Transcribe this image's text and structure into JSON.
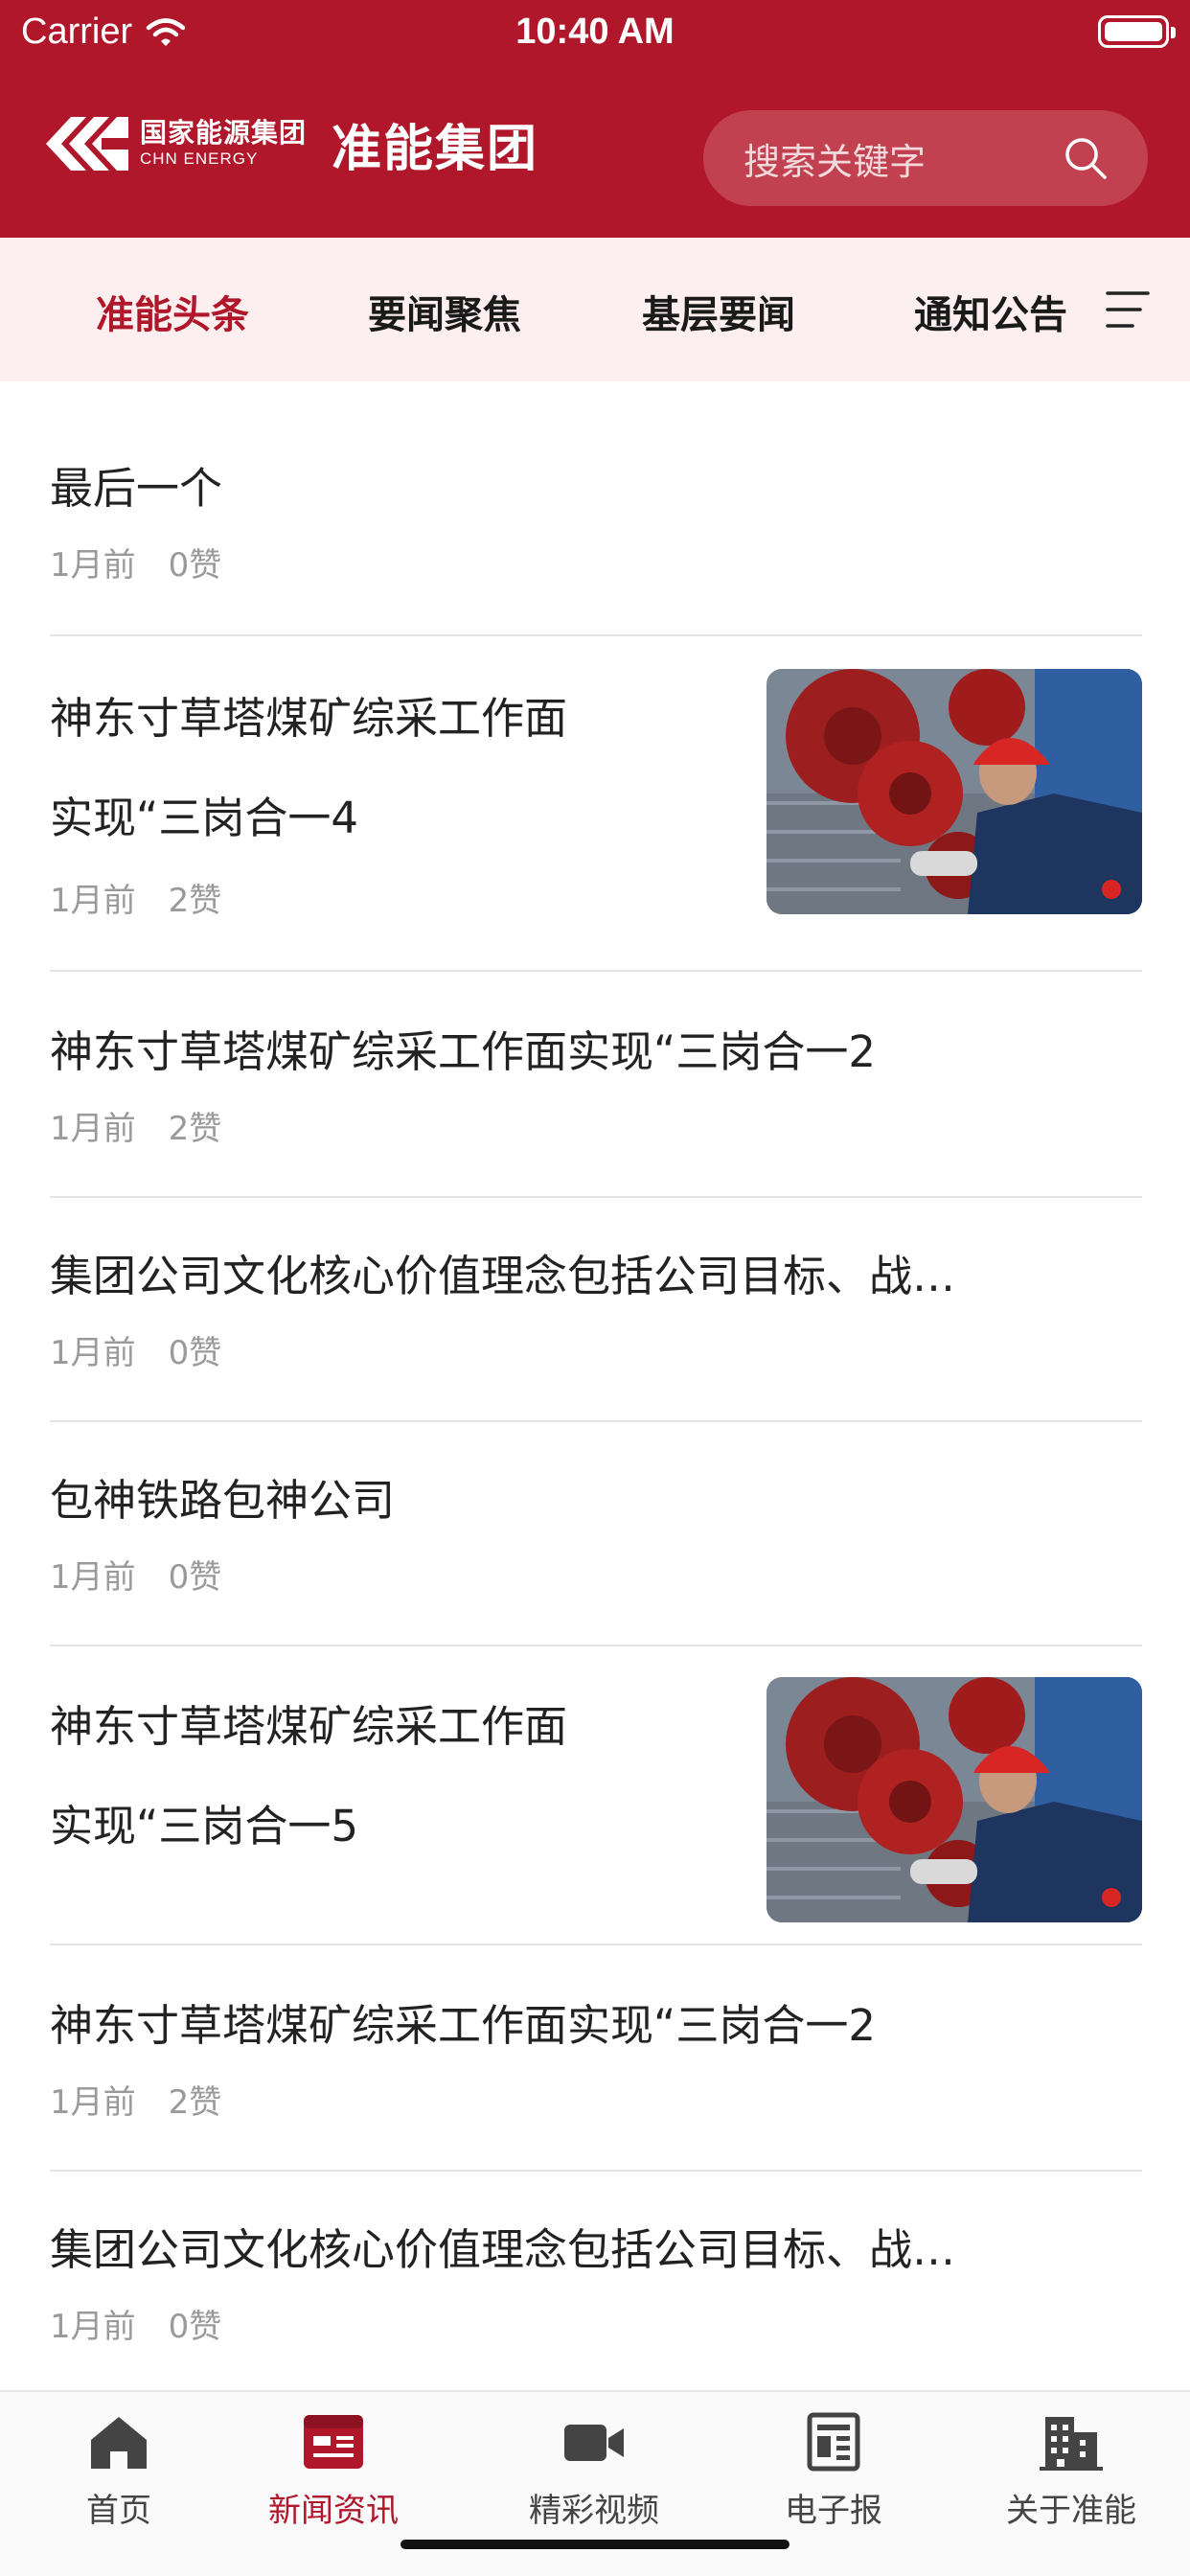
{
  "status_bar": {
    "carrier": "Carrier",
    "time": "10:40 AM"
  },
  "header": {
    "logo_cn": "国家能源集团",
    "logo_en": "CHN ENERGY",
    "brand_name": "准能集团",
    "search_placeholder": "搜索关键字",
    "accent_color": "#b0172b"
  },
  "tabs": {
    "items": [
      "准能头条",
      "要闻聚焦",
      "基层要闻",
      "通知公告"
    ],
    "active": "准能头条",
    "menu_icon": "menu-lines-icon"
  },
  "news": [
    {
      "title": "最后一个",
      "time": "1月前",
      "likes": "0赞",
      "has_image": false
    },
    {
      "title_line1": "神东寸草塔煤矿综采工作面",
      "title_line2": "实现“三岗合一4",
      "time": "1月前",
      "likes": "2赞",
      "has_image": true
    },
    {
      "title": "神东寸草塔煤矿综采工作面实现“三岗合一2",
      "time": "1月前",
      "likes": "2赞",
      "has_image": false
    },
    {
      "title": "集团公司文化核心价值理念包括公司目标、战…",
      "time": "1月前",
      "likes": "0赞",
      "has_image": false
    },
    {
      "title": "包神铁路包神公司",
      "time": "1月前",
      "likes": "0赞",
      "has_image": false
    },
    {
      "title_line1": "神东寸草塔煤矿综采工作面",
      "title_line2": "实现“三岗合一5",
      "time": "1月前",
      "likes": "2赞",
      "has_image": true
    },
    {
      "title": "神东寸草塔煤矿综采工作面实现“三岗合一2",
      "time": "1月前",
      "likes": "2赞",
      "has_image": false
    },
    {
      "title": "集团公司文化核心价值理念包括公司目标、战…",
      "time": "1月前",
      "likes": "0赞",
      "has_image": false
    }
  ],
  "tab_bar": {
    "items": [
      {
        "label": "首页",
        "icon": "home-icon"
      },
      {
        "label": "新闻资讯",
        "icon": "news-icon"
      },
      {
        "label": "精彩视频",
        "icon": "video-icon"
      },
      {
        "label": "电子报",
        "icon": "newspaper-icon"
      },
      {
        "label": "关于准能",
        "icon": "building-icon"
      }
    ],
    "active": "新闻资讯"
  }
}
